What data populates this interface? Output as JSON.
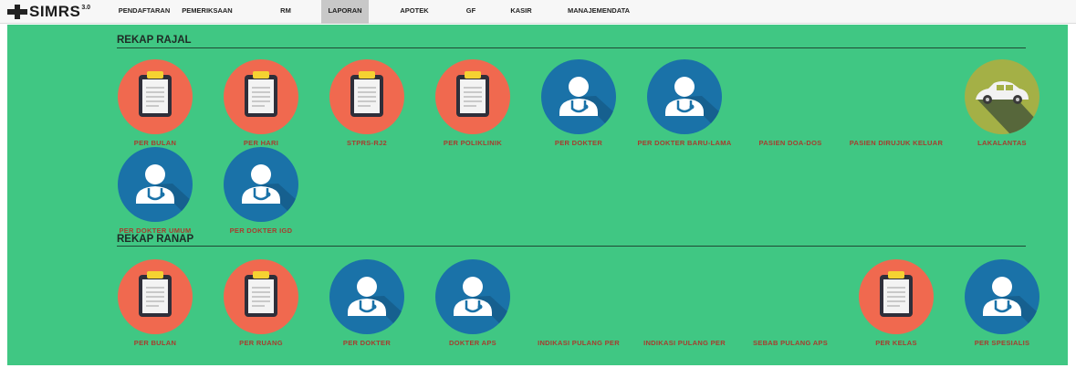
{
  "app": {
    "logo_text": "SIMRS",
    "logo_version": "3.0"
  },
  "nav": {
    "items": [
      {
        "label": "PENDAFTARAN"
      },
      {
        "label": "PEMERIKSAAN"
      },
      {
        "label": "RM"
      },
      {
        "label": "LAPORAN",
        "active": true
      },
      {
        "label": "APOTEK"
      },
      {
        "label": "GF"
      },
      {
        "label": "KASIR"
      },
      {
        "label": "MANAJEMENDATA"
      }
    ]
  },
  "colors": {
    "background": "#40c783",
    "icon_red": "#f0694f",
    "icon_blue": "#1a72a8",
    "icon_olive": "#a4b046",
    "label": "#a63d2e"
  },
  "rajal": {
    "title": "REKAP RAJAL",
    "tiles": [
      {
        "icon": "clipboard-icon",
        "label": "PER BULAN"
      },
      {
        "icon": "clipboard-icon",
        "label": "PER HARI"
      },
      {
        "icon": "clipboard-icon",
        "label": "STPRS-RJ2"
      },
      {
        "icon": "clipboard-icon",
        "label": "PER POLIKLINIK"
      },
      {
        "icon": "doctor-icon",
        "label": "PER DOKTER"
      },
      {
        "icon": "doctor-icon",
        "label": "PER DOKTER BARU-LAMA"
      },
      {
        "icon": "none",
        "label": "PASIEN DOA-DOS"
      },
      {
        "icon": "none",
        "label": "PASIEN DIRUJUK KELUAR"
      },
      {
        "icon": "car-icon",
        "label": "LAKALANTAS"
      },
      {
        "icon": "doctor-icon",
        "label": "PER DOKTER UMUM"
      },
      {
        "icon": "doctor-icon",
        "label": "PER DOKTER IGD"
      }
    ]
  },
  "ranap": {
    "title": "REKAP RANAP",
    "tiles": [
      {
        "icon": "clipboard-icon",
        "label": "PER BULAN"
      },
      {
        "icon": "clipboard-icon",
        "label": "PER RUANG"
      },
      {
        "icon": "doctor-icon",
        "label": "PER DOKTER"
      },
      {
        "icon": "doctor-icon",
        "label": "DOKTER APS"
      },
      {
        "icon": "none",
        "label": "INDIKASI PULANG PER"
      },
      {
        "icon": "none",
        "label": "INDIKASI PULANG PER"
      },
      {
        "icon": "none",
        "label": "SEBAB PULANG APS"
      },
      {
        "icon": "clipboard-icon",
        "label": "PER KELAS"
      },
      {
        "icon": "doctor-icon",
        "label": "PER SPESIALIS"
      }
    ]
  }
}
